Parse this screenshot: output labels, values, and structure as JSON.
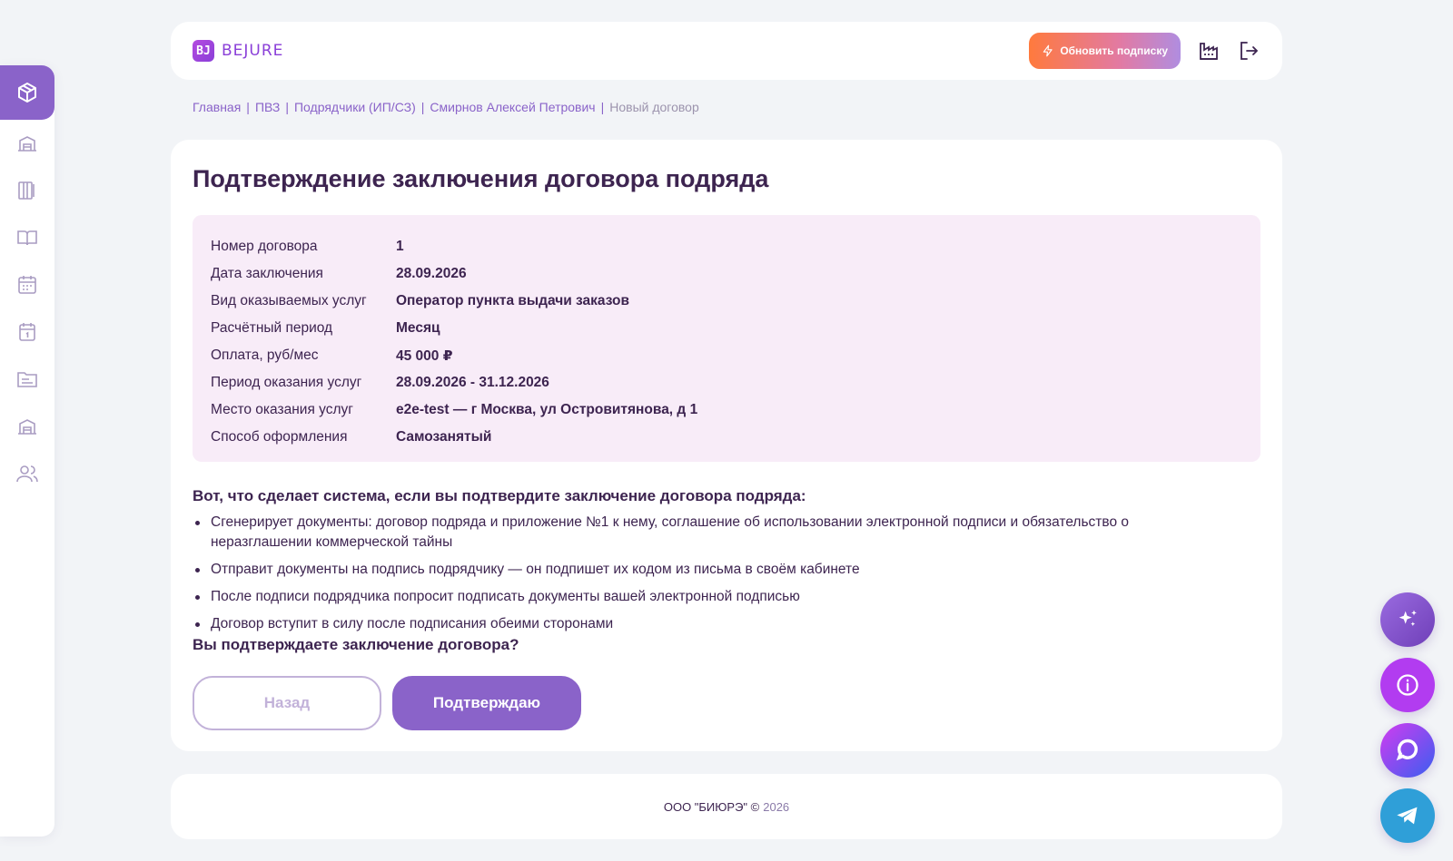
{
  "header": {
    "logo_mark": "BJ",
    "logo_text": "BEJURE",
    "upgrade_label": "Обновить подписку",
    "icons": [
      "lightning-icon",
      "factory-icon",
      "logout-icon"
    ]
  },
  "sidebar": {
    "items": [
      {
        "name": "package",
        "icon": "package-icon",
        "active": true
      },
      {
        "name": "warehouse",
        "icon": "warehouse-icon"
      },
      {
        "name": "documents",
        "icon": "binders-icon"
      },
      {
        "name": "guide",
        "icon": "book-icon"
      },
      {
        "name": "calendar",
        "icon": "calendar-icon"
      },
      {
        "name": "schedule",
        "icon": "calendar-day-icon"
      },
      {
        "name": "folders",
        "icon": "folder-icon"
      },
      {
        "name": "buildings",
        "icon": "warehouse-icon"
      },
      {
        "name": "users",
        "icon": "users-icon"
      }
    ]
  },
  "breadcrumb": {
    "items": [
      "Главная",
      "ПВЗ",
      "Подрядчики (ИП/СЗ)",
      "Смирнов Алексей Петрович"
    ],
    "separator": "|",
    "current": "Новый договор"
  },
  "main": {
    "title": "Подтверждение заключения договора подряда",
    "details": [
      {
        "label": "Номер договора",
        "value": "1"
      },
      {
        "label": "Дата заключения",
        "value": "28.09.2026"
      },
      {
        "label": "Вид оказываемых услуг",
        "value": "Оператор пункта выдачи заказов"
      },
      {
        "label": "Расчётный период",
        "value": "Месяц"
      },
      {
        "label": "Оплата, руб/мес",
        "value": "45 000 ₽"
      },
      {
        "label": "Период оказания услуг",
        "value": "28.09.2026 - 31.12.2026"
      },
      {
        "label": "Место оказания услуг",
        "value": "e2e-test — г Москва, ул Островитянова, д 1"
      },
      {
        "label": "Способ оформления",
        "value": "Самозанятый"
      }
    ],
    "steps_title": "Вот, что сделает система, если вы подтвердите заключение договора подряда:",
    "steps": [
      "Сгенерирует документы: договор подряда и приложение №1 к нему, соглашение об использовании электронной подписи и обязательство о неразглашении коммерческой тайны",
      "Отправит документы на подпись подрядчику — он подпишет их кодом из письма в своём кабинете",
      "После подписи подрядчика попросит подписать документы вашей электронной подписью",
      "Договор вступит в силу после подписания обеими сторонами"
    ],
    "question": "Вы подтверждаете заключение договора?",
    "back_label": "Назад",
    "confirm_label": "Подтверждаю"
  },
  "footer": {
    "company": "ООО \"БИЮРЭ\" ©",
    "year": "2026"
  },
  "floating": [
    "sparkles-icon",
    "info-icon",
    "chat-icon",
    "telegram-icon"
  ],
  "colors": {
    "accent": "#8a63c9",
    "text": "#3d2450",
    "details_bg": "#f8ecf8",
    "page_bg": "#f2f4f7"
  }
}
